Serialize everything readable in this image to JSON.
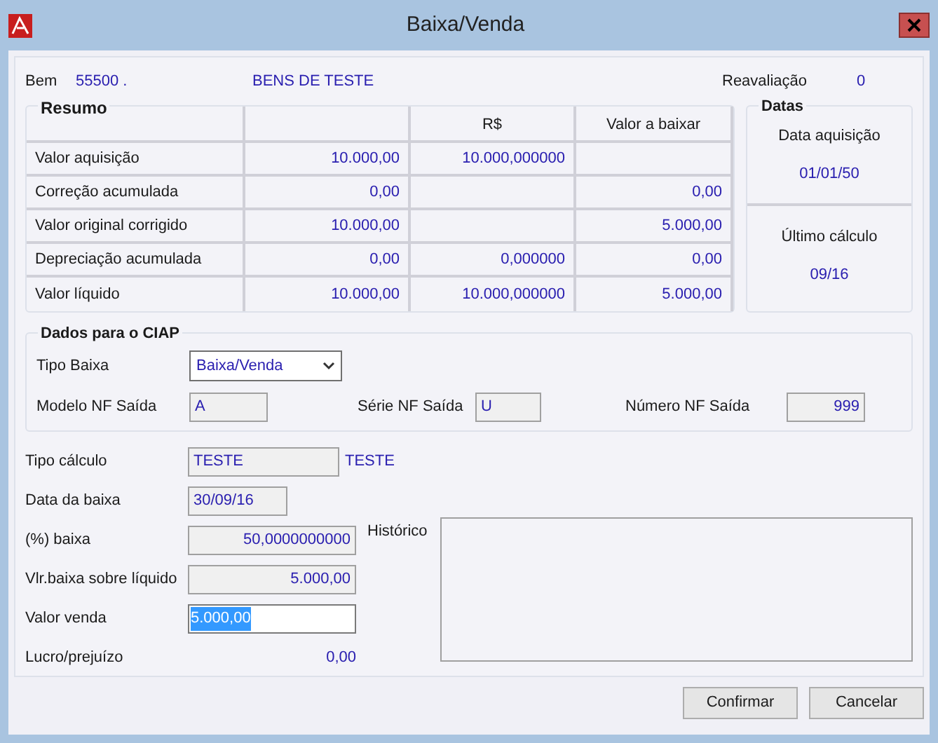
{
  "window": {
    "title": "Baixa/Venda"
  },
  "header": {
    "bem_label": "Bem",
    "bem_code": "55500 .",
    "bem_name": "BENS DE TESTE",
    "reavaliacao_label": "Reavaliação",
    "reavaliacao_value": "0"
  },
  "resumo": {
    "title": "Resumo",
    "columns": [
      "R$",
      "Valor a baixar"
    ],
    "rows": [
      {
        "label": "Valor aquisição",
        "column_2": "10.000,00",
        "rs": "10.000,000000"
      },
      {
        "label": "Correção acumulada",
        "column_2": "0,00",
        "valor_a_baixar": "0,00"
      },
      {
        "label": "Valor original corrigido",
        "column_2": "10.000,00",
        "valor_a_baixar": "5.000,00"
      },
      {
        "label": "Depreciação acumulada",
        "column_2": "0,00",
        "rs": "0,000000",
        "valor_a_baixar": "0,00"
      },
      {
        "label": "Valor líquido",
        "column_2": "10.000,00",
        "rs": "10.000,000000",
        "valor_a_baixar": "5.000,00"
      }
    ]
  },
  "datas": {
    "title": "Datas",
    "items": [
      {
        "label": "Data aquisição",
        "value": "01/01/50"
      },
      {
        "label": "Último cálculo",
        "value": "09/16"
      }
    ]
  },
  "ciap": {
    "title": "Dados para o CIAP",
    "tipo_baixa": {
      "label": "Tipo Baixa",
      "value": "Baixa/Venda"
    },
    "modelo": {
      "label": "Modelo NF Saída",
      "value": "A"
    },
    "serie": {
      "label": "Série NF Saída",
      "value": "U"
    },
    "numero": {
      "label": "Número NF Saída",
      "value": "999"
    }
  },
  "fields": [
    {
      "kind": "text",
      "label": "Tipo cálculo",
      "value": "TESTE",
      "description": "TESTE"
    },
    {
      "kind": "date",
      "label": "Data da baixa",
      "value": "30/09/16"
    },
    {
      "kind": "number",
      "label": "(%) baixa",
      "value": "50,0000000000"
    },
    {
      "kind": "number",
      "label": "Vlr.baixa sobre líquido",
      "value": "5.000,00"
    },
    {
      "kind": "input",
      "label": "Valor venda",
      "value": "5.000,00",
      "text_selected": true
    },
    {
      "kind": "readout",
      "label": "Lucro/prejuízo",
      "value": "0,00"
    }
  ],
  "historico": {
    "label": "Histórico"
  },
  "buttons": [
    "Confirmar",
    "Cancelar"
  ]
}
